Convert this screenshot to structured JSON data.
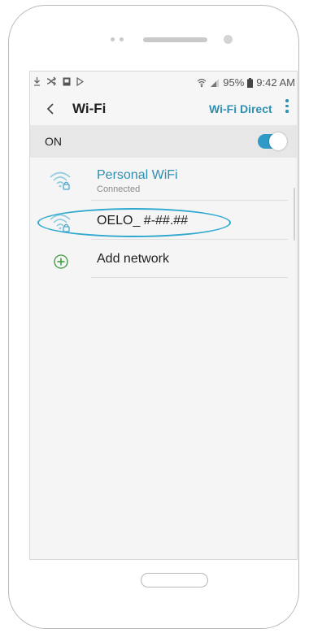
{
  "status_bar": {
    "battery_percent": "95%",
    "time": "9:42 AM"
  },
  "toolbar": {
    "title": "Wi-Fi",
    "wifi_direct_label": "Wi-Fi Direct"
  },
  "toggle": {
    "label": "ON",
    "state": "on"
  },
  "networks": [
    {
      "name": "Personal WiFi",
      "status": "Connected",
      "icon": "wifi-locked-icon"
    },
    {
      "name": "OELO_ #-##.##",
      "icon": "wifi-locked-icon"
    }
  ],
  "add_network": {
    "label": "Add network",
    "icon": "plus-circle-icon"
  },
  "colors": {
    "accent": "#2d8fb1",
    "toggle": "#2f9ac6",
    "highlight": "#2fa8d0"
  }
}
